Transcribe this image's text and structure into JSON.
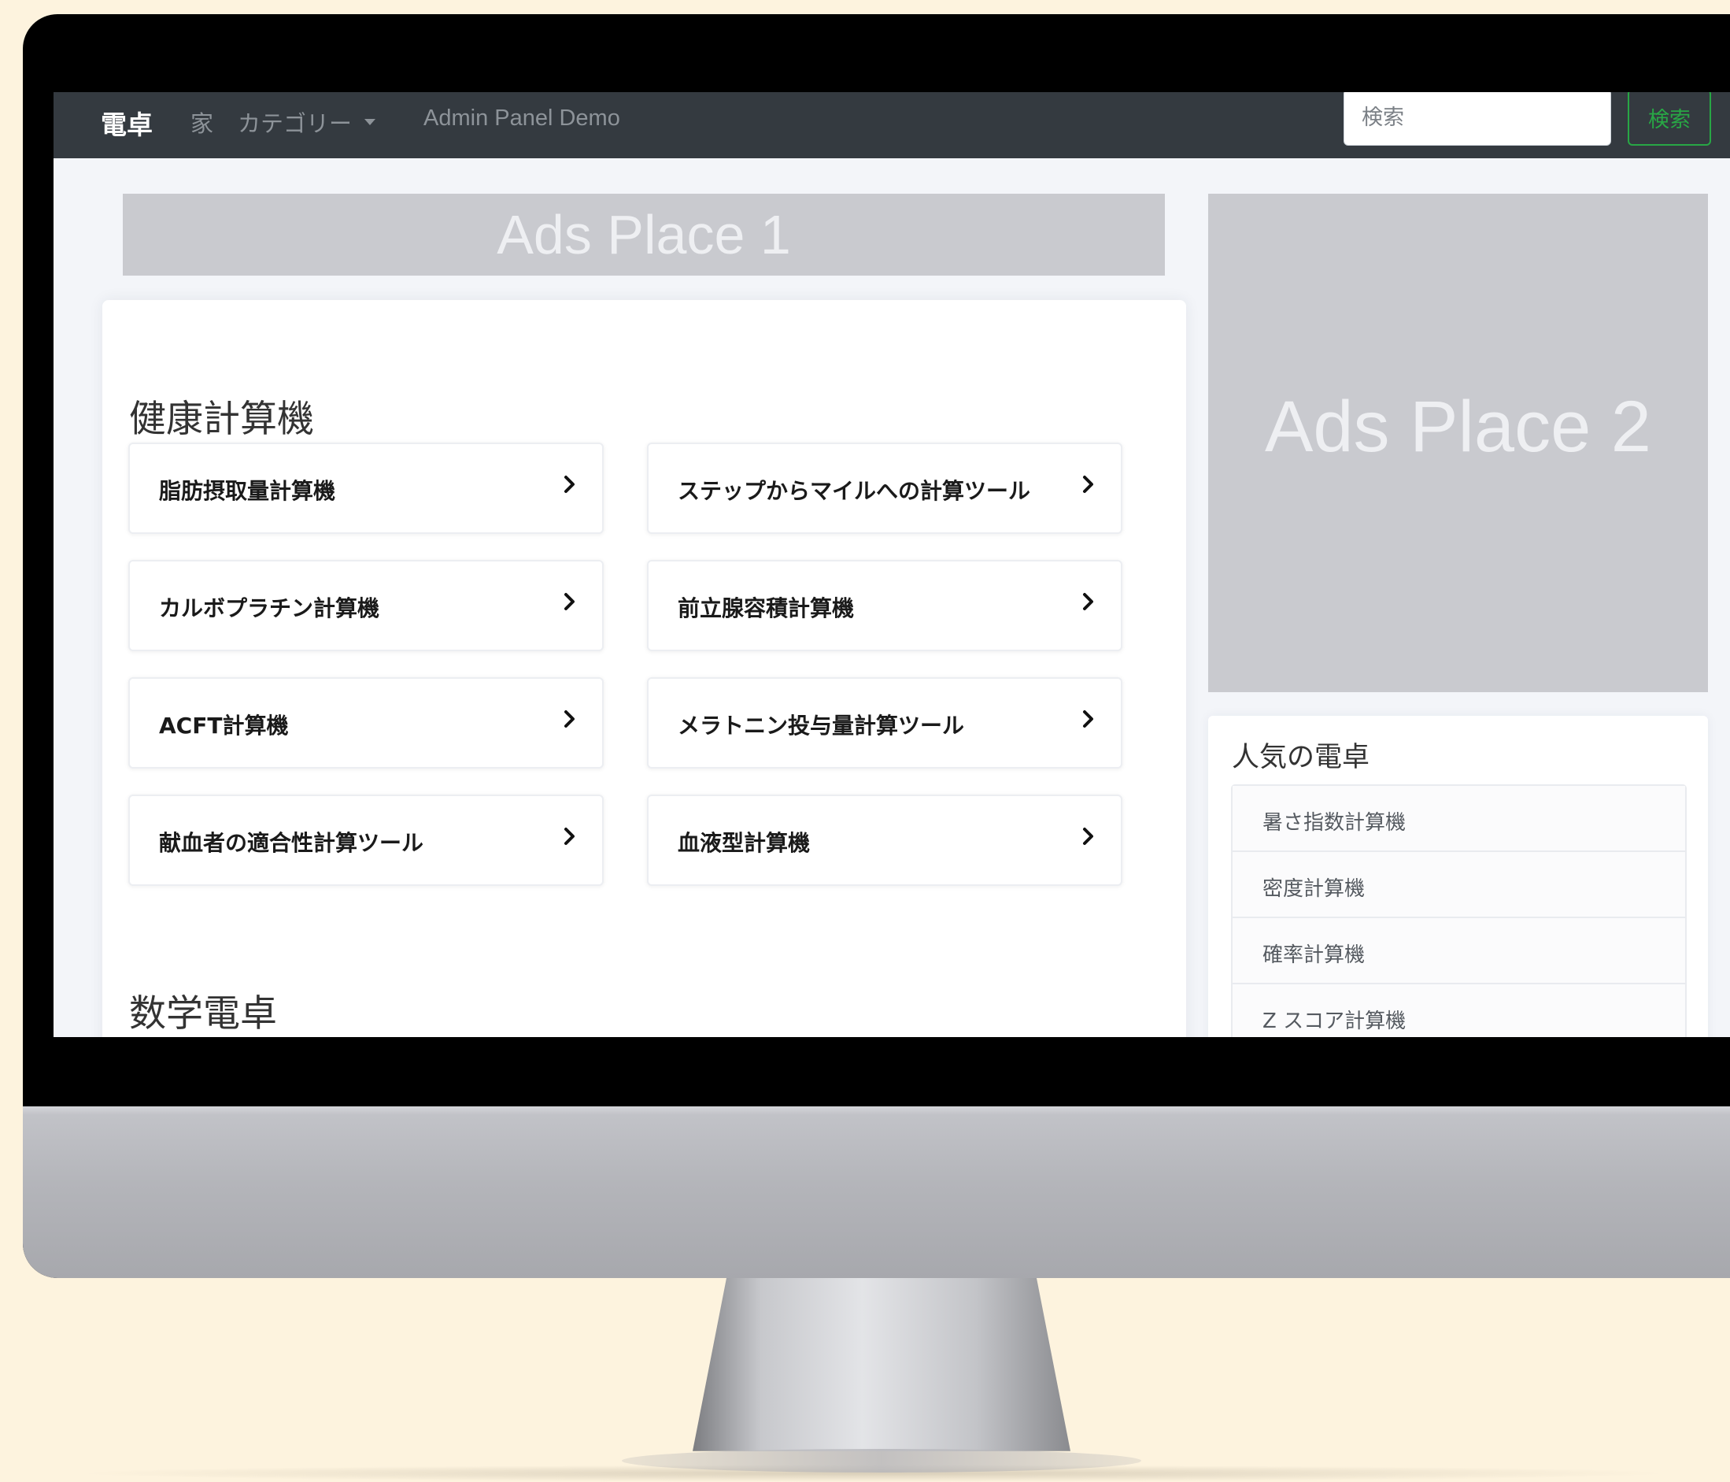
{
  "navbar": {
    "brand": "電卓",
    "home": "家",
    "category": "カテゴリー",
    "admin": "Admin Panel Demo",
    "search_placeholder": "検索",
    "search_button": "検索"
  },
  "ads": {
    "place1": "Ads Place 1",
    "place2": "Ads Place 2"
  },
  "sections": [
    {
      "title": "健康計算機",
      "items": [
        "脂肪摂取量計算機",
        "ステップからマイルへの計算ツール",
        "カルボプラチン計算機",
        "前立腺容積計算機",
        "ACFT計算機",
        "メラトニン投与量計算ツール",
        "献血者の適合性計算ツール",
        "血液型計算機"
      ]
    },
    {
      "title": "数学電卓"
    }
  ],
  "popular": {
    "title": "人気の電卓",
    "items": [
      "暑さ指数計算機",
      "密度計算機",
      "確率計算機",
      "Z スコア計算機"
    ]
  },
  "icons": {
    "chevron": "chevron-right-icon",
    "caret": "caret-down-icon"
  },
  "colors": {
    "navbar": "#343a40",
    "search_button_border": "#28a745",
    "ad_background": "#c9cacf",
    "page_background": "#fdf3de"
  }
}
